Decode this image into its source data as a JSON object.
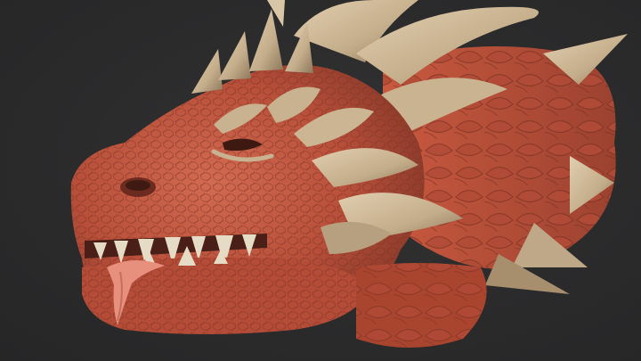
{
  "scene": {
    "subject": "dragon-head-render",
    "colors": {
      "background": "#2a2a2b",
      "scales_red": "#c25a43",
      "scales_dark": "#8e3a2b",
      "horn_bone": "#cdb898",
      "horn_shadow": "#8f7a5f",
      "tongue": "#e8907e",
      "teeth": "#e6dcc6"
    }
  }
}
